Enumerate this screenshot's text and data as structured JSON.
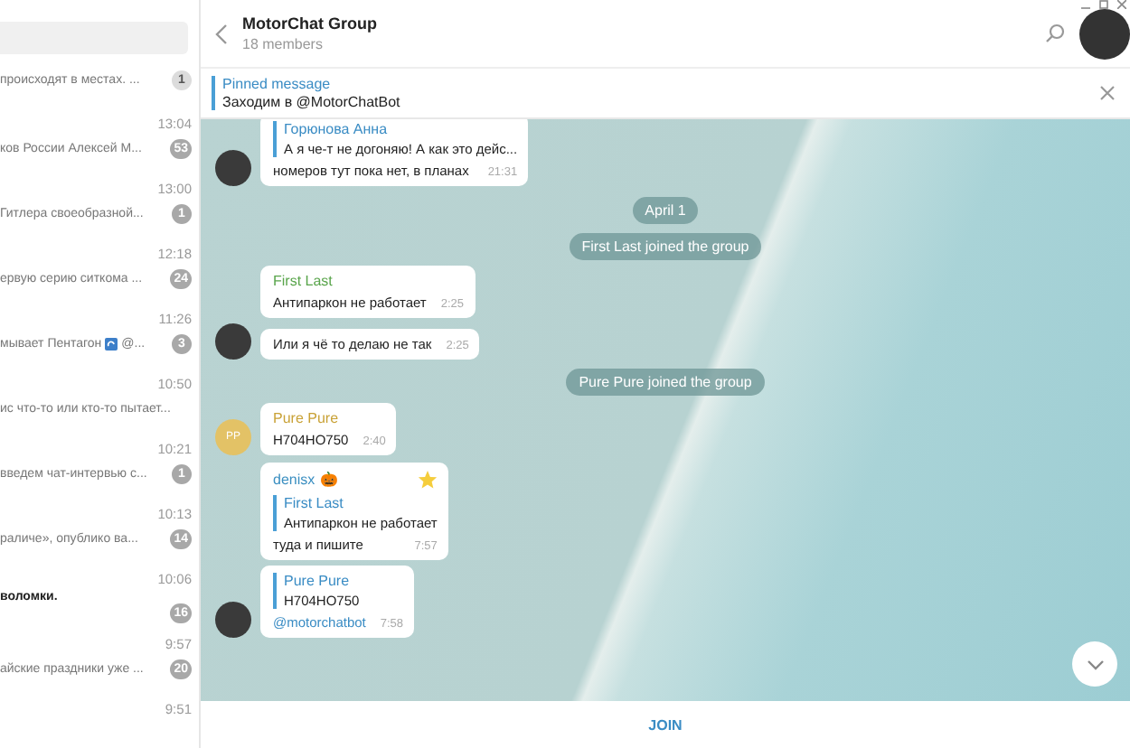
{
  "sidebar": {
    "chats": [
      {
        "preview": "происходят в местах. ...",
        "badge": "1",
        "muted": true,
        "bold": false
      },
      {
        "time": "13:04",
        "preview": "ков России Алексей М...",
        "badge": "53",
        "muted": false
      },
      {
        "time": "13:00",
        "preview": "Гитлера своеобразной...",
        "badge": "1",
        "muted": false
      },
      {
        "time": "12:18",
        "preview": "ервую серию ситкома ...",
        "badge": "24",
        "muted": false
      },
      {
        "time": "11:26",
        "preview": "мывает Пентагон",
        "preview_end": "@...",
        "badge": "3",
        "muted": false
      },
      {
        "time": "10:50",
        "preview": "ис что-то или кто-то пытает..."
      },
      {
        "time": "10:21",
        "preview": "введем чат-интервью с...",
        "badge": "1",
        "muted": false
      },
      {
        "time": "10:13",
        "preview": "раличе», опублико ва...",
        "badge": "14",
        "muted": false
      },
      {
        "time": "10:06",
        "preview": "воломки.",
        "bold": true,
        "badge": "16",
        "muted": false
      },
      {
        "time": "9:57",
        "preview": "айские праздники уже ...",
        "badge": "20",
        "muted": false
      },
      {
        "time": "9:51"
      }
    ]
  },
  "header": {
    "title": "MotorChat Group",
    "subtitle": "18 members"
  },
  "pinned": {
    "label": "Pinned message",
    "text": "Заходим в @MotorChatBot"
  },
  "messages": [
    {
      "kind": "message",
      "reply": {
        "author": "Горюнова Анна",
        "text": "А я че-т не догоняю! А как это дейс..."
      },
      "text": "номеров тут пока нет, в планах",
      "time": "21:31",
      "avatar": {
        "kind": "photo"
      }
    },
    {
      "kind": "date",
      "text": "April 1"
    },
    {
      "kind": "service",
      "text": "First Last joined the group"
    },
    {
      "kind": "message",
      "author": "First Last",
      "color": "#5aa54c",
      "text": "Антипаркон не работает",
      "time": "2:25"
    },
    {
      "kind": "message",
      "text": "Или я чё то делаю не так",
      "time": "2:25",
      "avatar": {
        "kind": "photo"
      }
    },
    {
      "kind": "service",
      "text": "Pure Pure joined the group"
    },
    {
      "kind": "message",
      "author": "Pure Pure",
      "color": "#c9a237",
      "text": "Н704НО750",
      "time": "2:40",
      "avatar": {
        "kind": "initials",
        "initials": "PP"
      }
    },
    {
      "kind": "message",
      "author": "denisx",
      "emoji": "🎃",
      "color": "#3b8fc1",
      "starred": true,
      "reply": {
        "author": "First Last",
        "text": "Антипаркон не работает"
      },
      "text": "туда и пишите",
      "time": "7:57"
    },
    {
      "kind": "message",
      "reply": {
        "author": "Pure Pure",
        "text": "Н704НО750"
      },
      "text": "@motorchatbot",
      "link": true,
      "time": "7:58",
      "avatar": {
        "kind": "photo"
      }
    }
  ],
  "join": "JOIN"
}
